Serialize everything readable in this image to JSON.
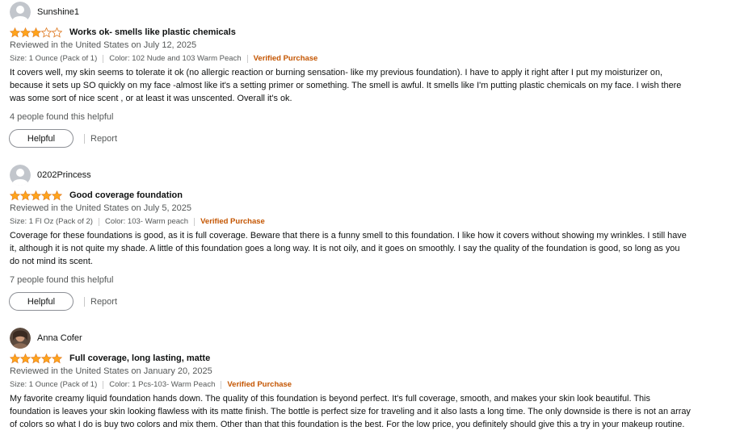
{
  "colors": {
    "star": "#ffa41c",
    "verified": "#c45500",
    "muted": "#565959"
  },
  "reviews": [
    {
      "avatar": "default-avatar-icon",
      "username": "Sunshine1",
      "rating": 3,
      "rating_max": 5,
      "title": "Works ok- smells like plastic chemicals",
      "date": "Reviewed in the United States on July 12, 2025",
      "size": "Size: 1 Ounce (Pack of 1)",
      "color": "Color: 102 Nude and 103 Warm Peach",
      "verified": "Verified Purchase",
      "body_lines": [
        "It covers well, my skin seems to tolerate it ok (no allergic reaction or burning sensation- like my previous foundation). I have to apply it right after I put my moisturizer on,",
        "because it sets up SO quickly on my face -almost like it's a setting primer or something. The smell is awful. It smells like I'm putting plastic chemicals on my face. I wish there",
        "was some sort of nice scent , or at least it was unscented. Overall it's ok."
      ],
      "helpful_count": "4 people found this helpful",
      "helpful_label": "Helpful",
      "report_label": "Report"
    },
    {
      "avatar": "default-avatar-icon",
      "username": "0202Princess",
      "rating": 5,
      "rating_max": 5,
      "title": "Good coverage foundation",
      "date": "Reviewed in the United States on July 5, 2025",
      "size": "Size: 1 Fl Oz (Pack of 2)",
      "color": "Color: 103- Warm peach",
      "verified": "Verified Purchase",
      "body_lines": [
        "Coverage for these foundations is good, as it is full coverage. Beware that there is a funny smell to this foundation. I like how it covers without showing my wrinkles. I still have",
        "it, although it is not quite my shade. A little of this foundation goes a long way. It is not oily, and it goes on smoothly. I say the quality of the foundation is good, so long as you",
        "do not mind its scent."
      ],
      "helpful_count": "7 people found this helpful",
      "helpful_label": "Helpful",
      "report_label": "Report"
    },
    {
      "avatar": "user-photo-avatar",
      "username": "Anna Cofer",
      "rating": 5,
      "rating_max": 5,
      "title": "Full coverage, long lasting, matte",
      "date": "Reviewed in the United States on January 20, 2025",
      "size": "Size: 1 Ounce (Pack of 1)",
      "color": "Color: 1 Pcs-103- Warm Peach",
      "verified": "Verified Purchase",
      "body_lines": [
        "My favorite creamy liquid foundation hands down. The quality of this foundation is beyond perfect. It's full coverage, smooth, and makes your skin look beautiful. This",
        "foundation is leaves your skin looking flawless with its matte finish. The bottle is perfect size for traveling and it also lasts a long time. The only downside is there is not an array",
        "of colors so what I do is buy two colors and mix them. Other than that this foundation is the best. For the low price, you definitely should give this a try in your makeup routine."
      ]
    }
  ]
}
